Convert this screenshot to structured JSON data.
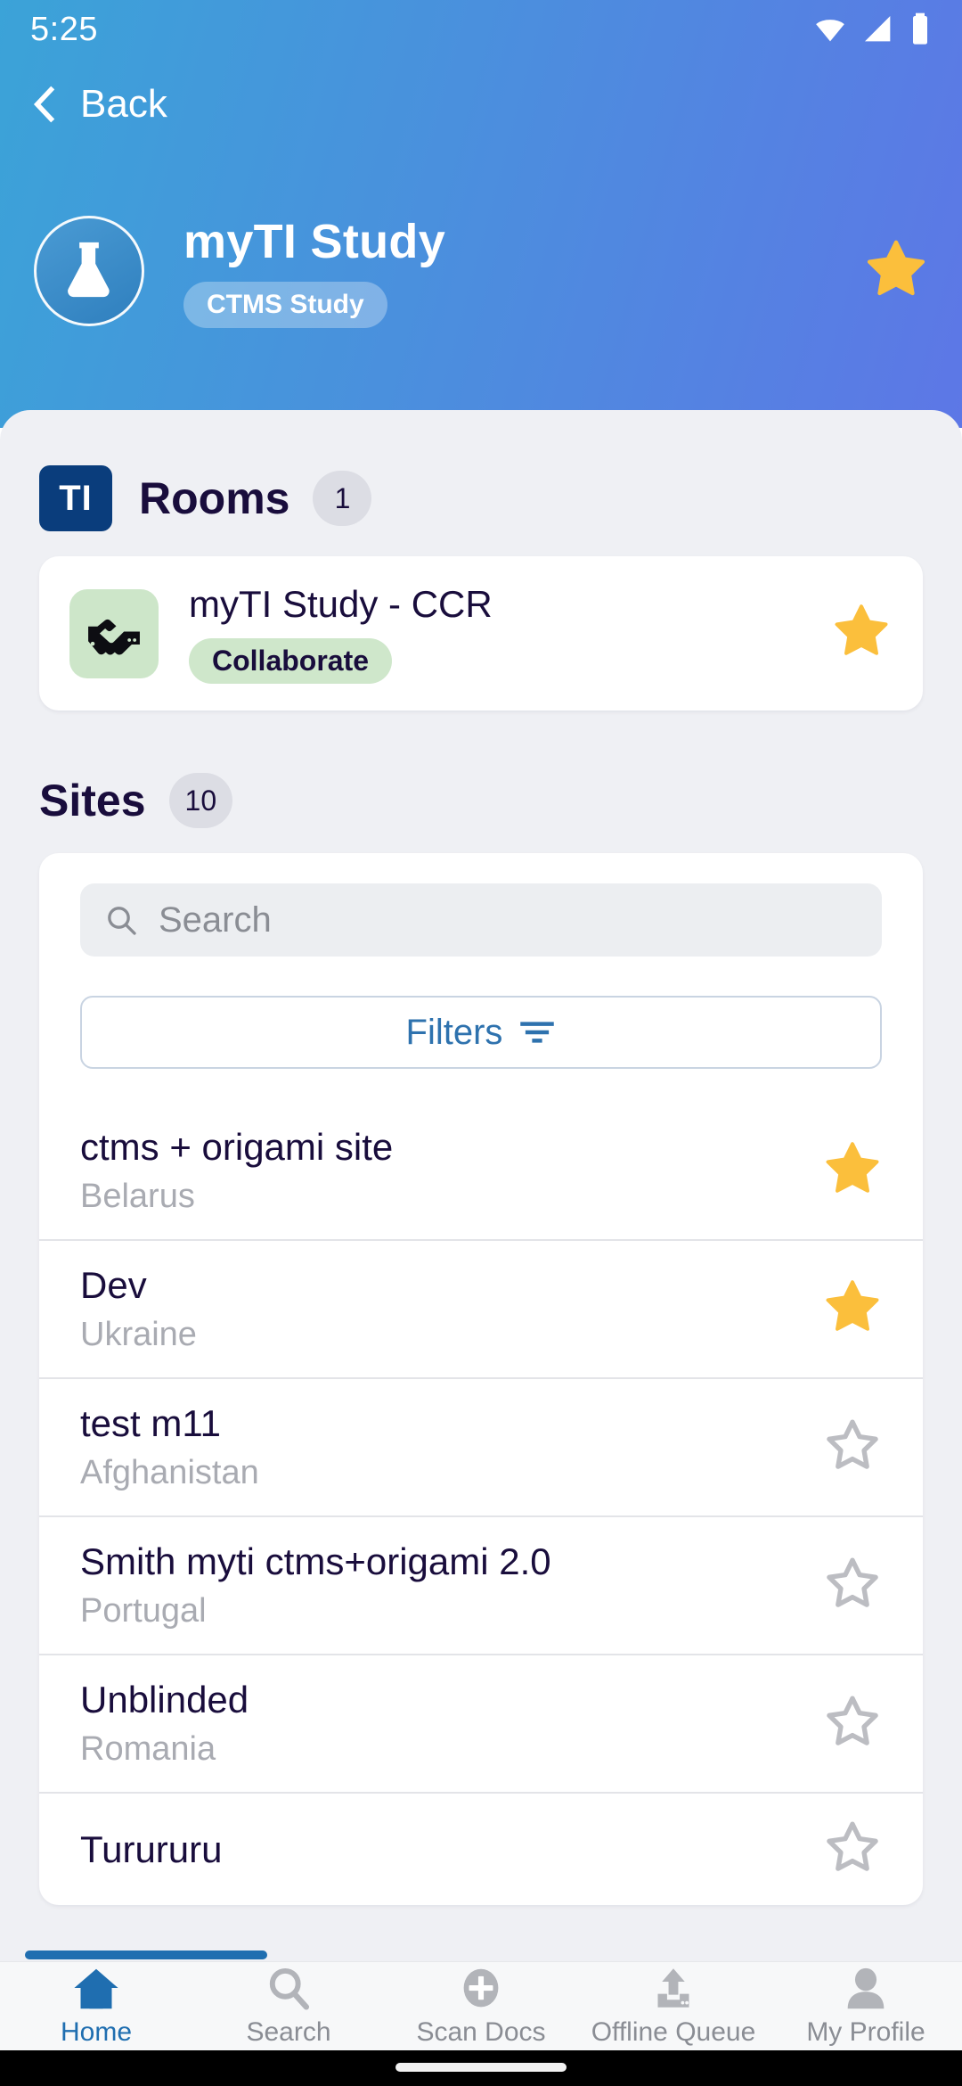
{
  "statusbar": {
    "time": "5:25",
    "icons": [
      "wifi-icon",
      "cellular-signal-icon",
      "battery-icon"
    ]
  },
  "nav": {
    "back_label": "Back",
    "back_icon": "chevron-left-icon"
  },
  "header": {
    "avatar_icon": "flask-icon",
    "title": "myTI Study",
    "badge": "CTMS Study",
    "favorite_icon": "star-filled-icon",
    "favorite": true,
    "gradient_from": "#3ba3d8",
    "gradient_to": "#5d77e6"
  },
  "rooms": {
    "badge_label": "TI",
    "title": "Rooms",
    "count": "1",
    "items": [
      {
        "icon": "handshake-icon",
        "name": "myTI Study - CCR",
        "badge": "Collaborate",
        "favorite": true,
        "favorite_icon": "star-filled-icon"
      }
    ]
  },
  "sites": {
    "title": "Sites",
    "count": "10",
    "search": {
      "placeholder": "Search",
      "value": "",
      "icon": "search-icon"
    },
    "filters": {
      "label": "Filters",
      "icon": "filter-lines-icon"
    },
    "items": [
      {
        "name": "ctms + origami site",
        "country": "Belarus",
        "favorite": true,
        "favorite_icon": "star-filled-icon"
      },
      {
        "name": "Dev",
        "country": "Ukraine",
        "favorite": true,
        "favorite_icon": "star-filled-icon"
      },
      {
        "name": "test m11",
        "country": "Afghanistan",
        "favorite": false,
        "favorite_icon": "star-outline-icon"
      },
      {
        "name": "Smith myti ctms+origami 2.0",
        "country": "Portugal",
        "favorite": false,
        "favorite_icon": "star-outline-icon"
      },
      {
        "name": "Unblinded",
        "country": "Romania",
        "favorite": false,
        "favorite_icon": "star-outline-icon"
      },
      {
        "name": "Turururu",
        "country": "",
        "favorite": false,
        "favorite_icon": "star-outline-icon"
      }
    ]
  },
  "bottomnav": {
    "active": "Home",
    "items": [
      {
        "label": "Home",
        "icon": "home-icon"
      },
      {
        "label": "Search",
        "icon": "search-icon"
      },
      {
        "label": "Scan Docs",
        "icon": "plus-circle-icon"
      },
      {
        "label": "Offline Queue",
        "icon": "upload-icon"
      },
      {
        "label": "My Profile",
        "icon": "person-icon"
      }
    ]
  },
  "colors": {
    "accent_blue": "#1f6eb0",
    "star_gold": "#fbbf3c",
    "navy_text": "#190d3c",
    "ti_badge": "#0a3d7c",
    "room_badge": "#cfe7cb",
    "sheet_bg": "#eff0f4"
  }
}
